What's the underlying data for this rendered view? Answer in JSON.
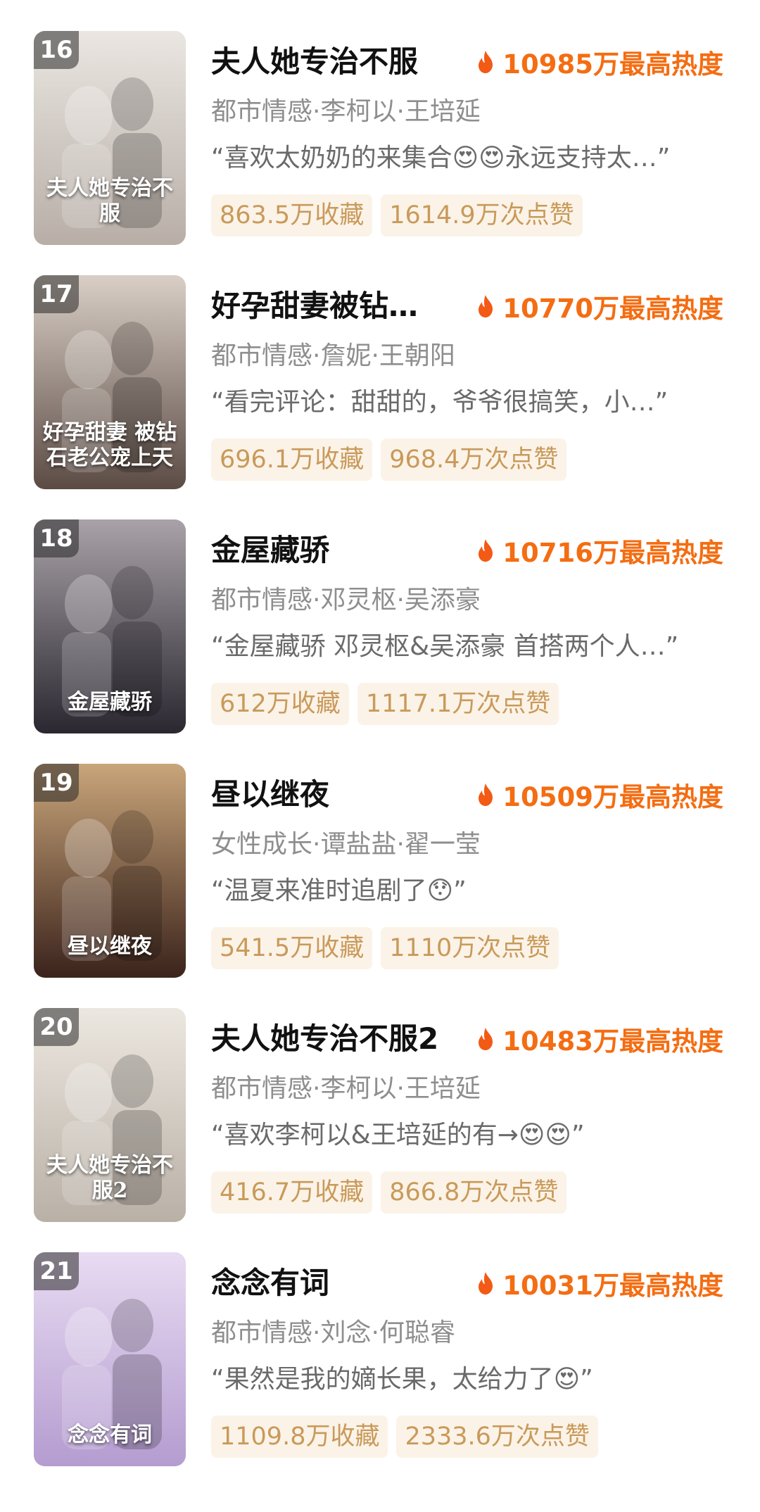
{
  "items": [
    {
      "rank": "16",
      "title": "夫人她专治不服",
      "heat": "10985万最高热度",
      "meta": "都市情感·李柯以·王培延",
      "quote": "“喜欢太奶奶的来集合😍😍永远支持太…”",
      "favorites": "863.5万收藏",
      "likes": "1614.9万次点赞",
      "poster_text": "夫人她专治不服",
      "poster_colors": [
        "#eae6e1",
        "#b8aea7"
      ]
    },
    {
      "rank": "17",
      "title": "好孕甜妻被钻…",
      "heat": "10770万最高热度",
      "meta": "都市情感·詹妮·王朝阳",
      "quote": "“看完评论：甜甜的，爷爷很搞笑，小…”",
      "favorites": "696.1万收藏",
      "likes": "968.4万次点赞",
      "poster_text": "好孕甜妻 被钻石老公宠上天",
      "poster_colors": [
        "#d9cfc6",
        "#5b4b44"
      ]
    },
    {
      "rank": "18",
      "title": "金屋藏骄",
      "heat": "10716万最高热度",
      "meta": "都市情感·邓灵枢·吴添豪",
      "quote": "“金屋藏骄 邓灵枢&吴添豪 首搭两个人…”",
      "favorites": "612万收藏",
      "likes": "1117.1万次点赞",
      "poster_text": "金屋藏骄",
      "poster_colors": [
        "#a9a2a8",
        "#2a2730"
      ]
    },
    {
      "rank": "19",
      "title": "昼以继夜",
      "heat": "10509万最高热度",
      "meta": "女性成长·谭盐盐·翟一莹",
      "quote": "“温夏来准时追剧了😯”",
      "favorites": "541.5万收藏",
      "likes": "1110万次点赞",
      "poster_text": "昼以继夜",
      "poster_colors": [
        "#c9a57a",
        "#3b231c"
      ]
    },
    {
      "rank": "20",
      "title": "夫人她专治不服2",
      "heat": "10483万最高热度",
      "meta": "都市情感·李柯以·王培延",
      "quote": "“喜欢李柯以&王培延的有→😍😍”",
      "favorites": "416.7万收藏",
      "likes": "866.8万次点赞",
      "poster_text": "夫人她专治不服2",
      "poster_colors": [
        "#ece7e0",
        "#b9b0a6"
      ]
    },
    {
      "rank": "21",
      "title": "念念有词",
      "heat": "10031万最高热度",
      "meta": "都市情感·刘念·何聪睿",
      "quote": "“果然是我的嫡长果，太给力了😍”",
      "favorites": "1109.8万收藏",
      "likes": "2333.6万次点赞",
      "poster_text": "念念有词",
      "poster_colors": [
        "#e8dbf2",
        "#b49cd0"
      ]
    }
  ],
  "colors": {
    "heat": "#f46d12",
    "tag_bg": "#fbf3e8",
    "tag_text": "#c99a5a",
    "meta": "#8e8e8e"
  }
}
